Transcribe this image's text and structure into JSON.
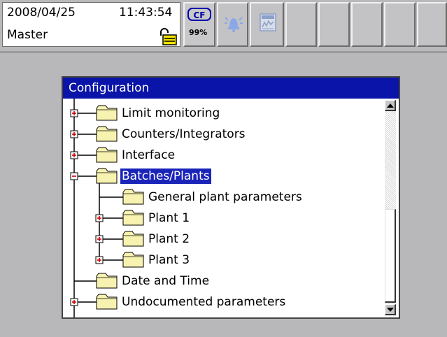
{
  "status": {
    "date": "2008/04/25",
    "time": "11:43:54",
    "user": "Master",
    "lock_icon": "padlock-open-icon"
  },
  "toolbar": {
    "cf_label": "CF",
    "cf_percent": "99%",
    "bell_icon": "alarm-bell-icon",
    "trend_icon": "trend-display-icon",
    "empty_button_count": 5
  },
  "dialog": {
    "title": "Configuration",
    "selected_index": 3,
    "items": [
      {
        "label": "Limit monitoring",
        "level": 0,
        "expander": "plus"
      },
      {
        "label": "Counters/Integrators",
        "level": 0,
        "expander": "plus"
      },
      {
        "label": "Interface",
        "level": 0,
        "expander": "plus"
      },
      {
        "label": "Batches/Plants",
        "level": 0,
        "expander": "minus"
      },
      {
        "label": "General plant parameters",
        "level": 1,
        "expander": "none"
      },
      {
        "label": "Plant 1",
        "level": 1,
        "expander": "plus"
      },
      {
        "label": "Plant 2",
        "level": 1,
        "expander": "plus"
      },
      {
        "label": "Plant 3",
        "level": 1,
        "expander": "plus"
      },
      {
        "label": "Date and Time",
        "level": 0,
        "expander": "none"
      },
      {
        "label": "Undocumented parameters",
        "level": 0,
        "expander": "plus"
      }
    ]
  },
  "colors": {
    "title_bar": "#0a14a8",
    "selection": "#1a24b8",
    "expander_sign": "#cc0000",
    "folder_fill": "#f7f2b0",
    "background": "#b8b8ba"
  }
}
